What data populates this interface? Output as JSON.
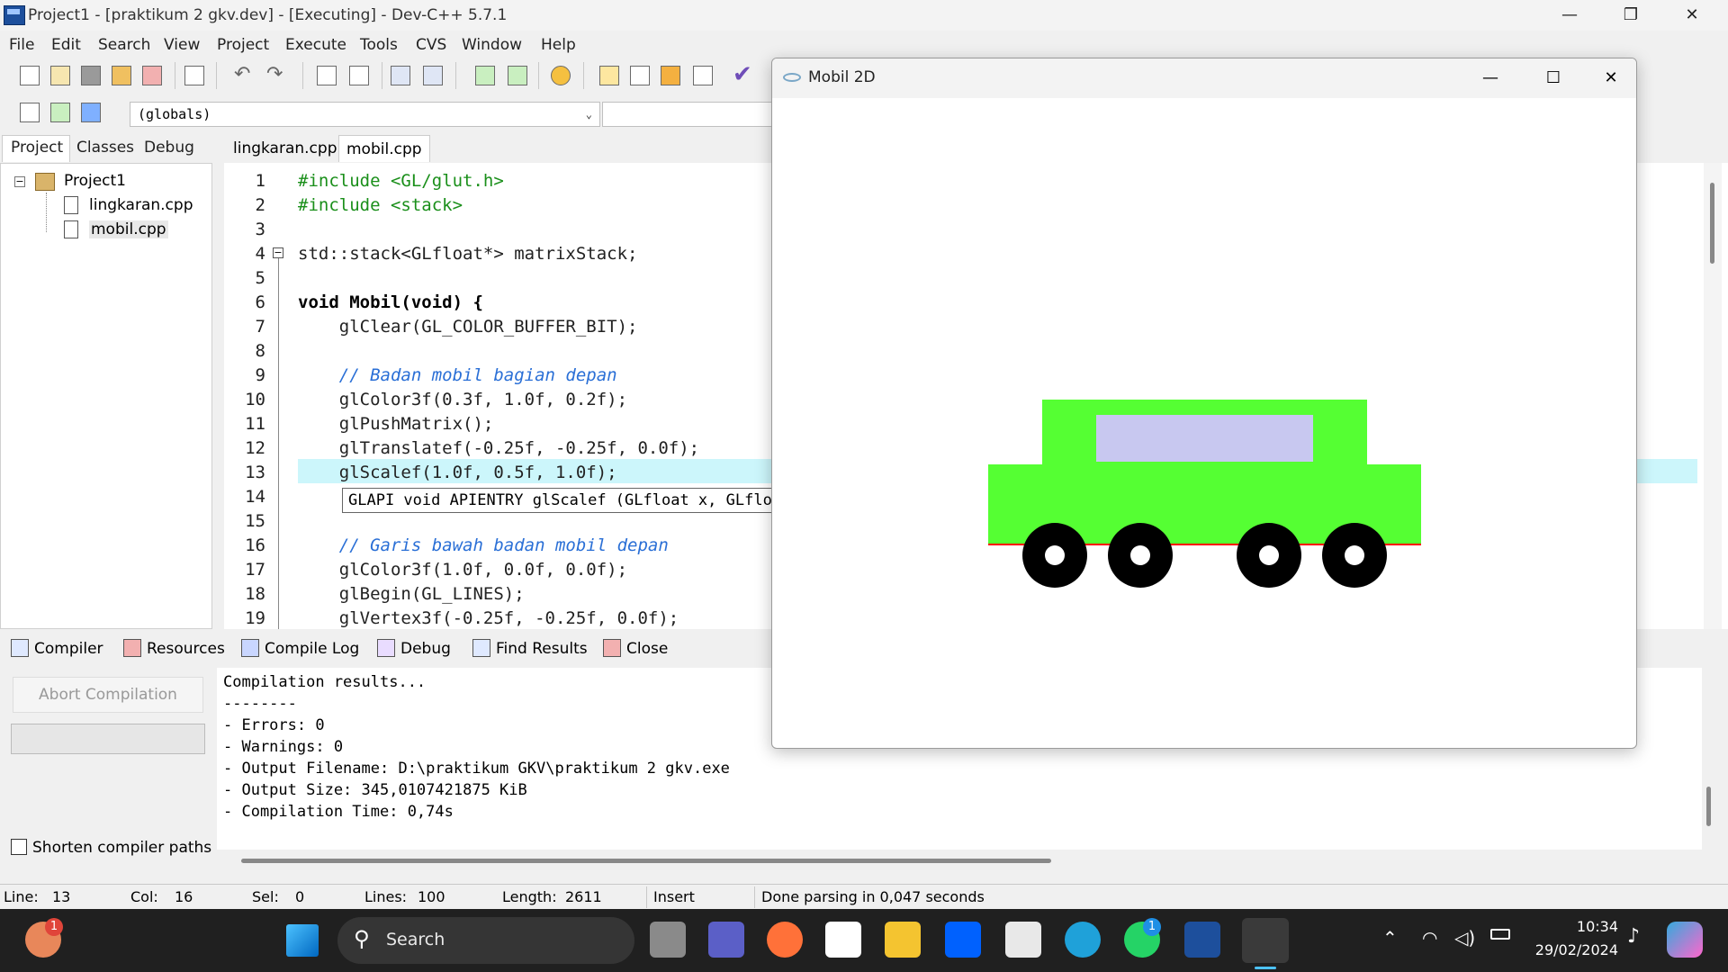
{
  "window": {
    "title": "Project1 - [praktikum 2 gkv.dev] - [Executing] - Dev-C++ 5.7.1"
  },
  "menu": [
    "File",
    "Edit",
    "Search",
    "View",
    "Project",
    "Execute",
    "Tools",
    "CVS",
    "Window",
    "Help"
  ],
  "toolbar": {
    "scope": "(globals)"
  },
  "left_tabs": [
    "Project",
    "Classes",
    "Debug"
  ],
  "tree": {
    "root": "Project1",
    "files": [
      "lingkaran.cpp",
      "mobil.cpp"
    ]
  },
  "editor_tabs": [
    "lingkaran.cpp",
    "mobil.cpp"
  ],
  "code_lines": [
    "1",
    "2",
    "3",
    "4",
    "5",
    "6",
    "7",
    "8",
    "9",
    "10",
    "11",
    "12",
    "13",
    "14",
    "15",
    "16",
    "17",
    "18",
    "19"
  ],
  "code": {
    "l1": "#include <GL/glut.h>",
    "l2": "#include <stack>",
    "l4": "std::stack<GLfloat*> matrixStack;",
    "l6": "void Mobil(void) {",
    "l7": "    glClear(GL_COLOR_BUFFER_BIT);",
    "l9": "    // Badan mobil bagian depan",
    "l10": "    glColor3f(0.3f, 1.0f, 0.2f);",
    "l11": "    glPushMatrix();",
    "l12": "    glTranslatef(-0.25f, -0.25f, 0.0f);",
    "l13": "    glScalef(1.0f, 0.5f, 1.0f);",
    "l16": "    // Garis bawah badan mobil depan",
    "l17": "    glColor3f(1.0f, 0.0f, 0.0f);",
    "l18": "    glBegin(GL_LINES);",
    "l19": "    glVertex3f(-0.25f, -0.25f, 0.0f);"
  },
  "tooltip": "GLAPI void APIENTRY glScalef (GLfloat x, GLfloat y, GLfloat z)",
  "bottom_tabs": [
    "Compiler",
    "Resources",
    "Compile Log",
    "Debug",
    "Find Results",
    "Close"
  ],
  "abort_label": "Abort Compilation",
  "shorten_label": "Shorten compiler paths",
  "log": [
    "Compilation results...",
    "--------",
    "- Errors: 0",
    "- Warnings: 0",
    "- Output Filename: D:\\praktikum GKV\\praktikum 2 gkv.exe",
    "- Output Size: 345,0107421875 KiB",
    "- Compilation Time: 0,74s"
  ],
  "status": {
    "line_label": "Line:",
    "line": "13",
    "col_label": "Col:",
    "col": "16",
    "sel_label": "Sel:",
    "sel": "0",
    "lines_label": "Lines:",
    "lines": "100",
    "length_label": "Length:",
    "length": "2611",
    "mode": "Insert",
    "message": "Done parsing in 0,047 seconds"
  },
  "gl_window": {
    "title": "Mobil 2D"
  },
  "colors": {
    "car_body": "#55ff33",
    "car_window": "#c8c8f0",
    "car_line": "#ff0000",
    "wheel": "#000000",
    "highlight": "#ccf6fb"
  },
  "taskbar": {
    "search": "Search",
    "time": "10:34",
    "date": "29/02/2024",
    "badge1": "1",
    "badge2": "1"
  }
}
